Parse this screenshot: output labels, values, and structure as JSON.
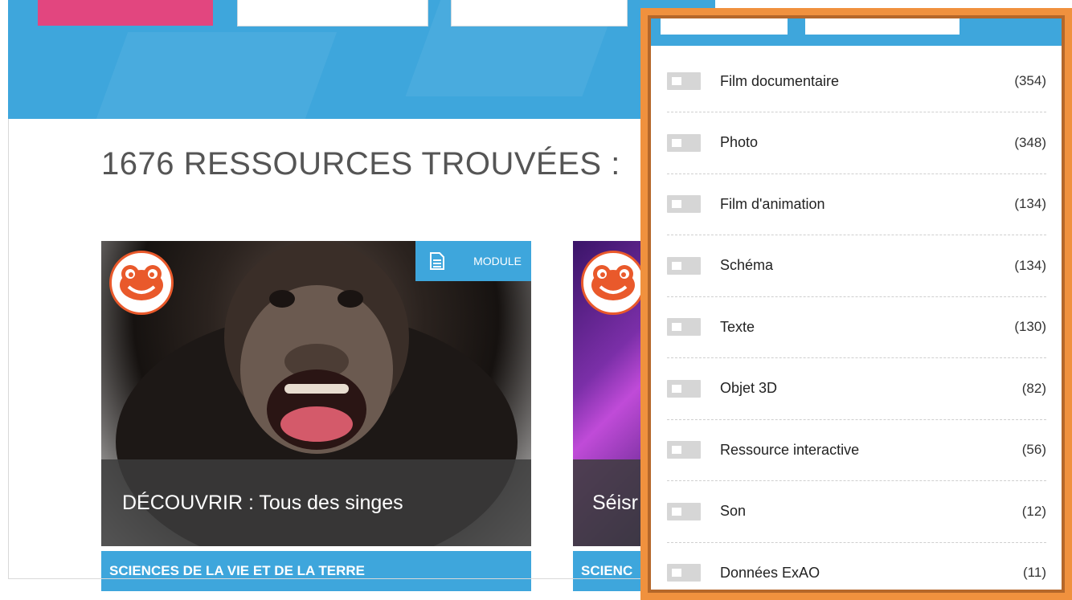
{
  "page": {
    "heading": "1676 RESSOURCES TROUVÉES :"
  },
  "cards": [
    {
      "badge_label": "MODULE",
      "title": "DÉCOUVRIR : Tous des singes",
      "category": "SCIENCES DE LA VIE ET DE LA TERRE"
    },
    {
      "title": "Séisr",
      "category": "SCIENC"
    }
  ],
  "filters": [
    {
      "label": "Film documentaire",
      "count": "(354)"
    },
    {
      "label": "Photo",
      "count": "(348)"
    },
    {
      "label": "Film d'animation",
      "count": "(134)"
    },
    {
      "label": "Schéma",
      "count": "(134)"
    },
    {
      "label": "Texte",
      "count": "(130)"
    },
    {
      "label": "Objet 3D",
      "count": "(82)"
    },
    {
      "label": "Ressource interactive",
      "count": "(56)"
    },
    {
      "label": "Son",
      "count": "(12)"
    },
    {
      "label": "Données ExAO",
      "count": "(11)"
    }
  ],
  "colors": {
    "accent_blue": "#3ea6dc",
    "highlight_orange": "#f0913e",
    "brand_pink": "#e2467f",
    "logo_orange": "#e9592b"
  },
  "icons": {
    "badge_icon": "document-icon",
    "logo_icon": "frog-logo-icon"
  }
}
